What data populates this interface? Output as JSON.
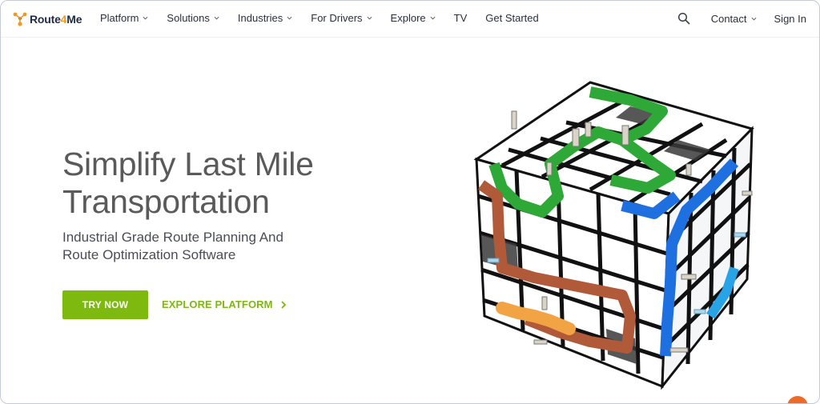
{
  "brand": {
    "name_part1": "Route",
    "name_part2": "4",
    "name_part3": "Me",
    "accent_color": "#f29a1f",
    "text_color": "#1f2a44"
  },
  "nav": {
    "items": [
      {
        "label": "Platform",
        "has_dropdown": true
      },
      {
        "label": "Solutions",
        "has_dropdown": true
      },
      {
        "label": "Industries",
        "has_dropdown": true
      },
      {
        "label": "For Drivers",
        "has_dropdown": true
      },
      {
        "label": "Explore",
        "has_dropdown": true
      },
      {
        "label": "TV",
        "has_dropdown": false
      },
      {
        "label": "Get Started",
        "has_dropdown": false
      }
    ],
    "right": {
      "search_icon": "search-icon",
      "contact_label": "Contact",
      "signin_label": "Sign In"
    }
  },
  "hero": {
    "title_line1": "Simplify Last Mile",
    "title_line2": "Transportation",
    "subtitle_line1": "Industrial Grade Route Planning And",
    "subtitle_line2": "Route Optimization Software",
    "cta_primary": "TRY NOW",
    "cta_secondary": "EXPLORE PLATFORM",
    "primary_color": "#7db90f"
  },
  "illustration": {
    "icon": "route-puzzle-cube-illustration"
  },
  "chat": {
    "icon": "chat-bubble-icon",
    "color": "#f06a26"
  }
}
